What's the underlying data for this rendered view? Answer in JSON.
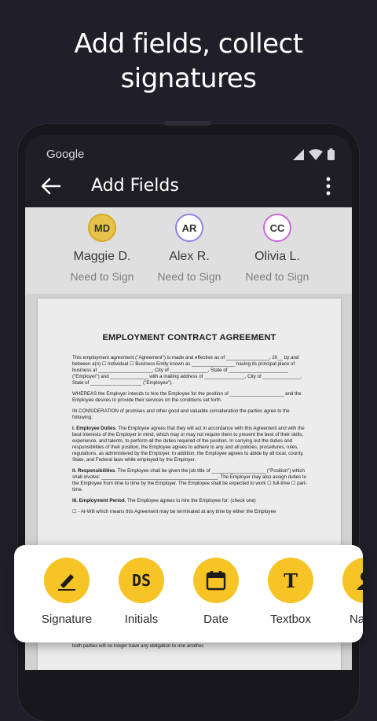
{
  "headline": {
    "line1": "Add fields, collect",
    "line2": "signatures"
  },
  "status_bar": {
    "carrier": "Google",
    "icons": [
      "signal-icon",
      "wifi-icon",
      "battery-icon"
    ]
  },
  "app_bar": {
    "title": "Add Fields",
    "back_icon": "arrow-left-icon",
    "more_icon": "more-vert-icon"
  },
  "signers": [
    {
      "initials": "MD",
      "name": "Maggie D.",
      "status": "Need to Sign",
      "color": "#d4a92a",
      "fill": "#e6c24a"
    },
    {
      "initials": "AR",
      "name": "Alex R.",
      "status": "Need to Sign",
      "color": "#8f82e8",
      "fill": "#ffffff"
    },
    {
      "initials": "CC",
      "name": "Olivia L.",
      "status": "Need to Sign",
      "color": "#c86ad6",
      "fill": "#ffffff"
    }
  ],
  "document": {
    "title": "EMPLOYMENT CONTRACT AGREEMENT",
    "p1": "This employment agreement (\"Agreement\") is made and effective as of ________________, 20__ by and between a(n) ☐ Individual ☐ Business Entity known as ________________ having its principal place of business at ____________________, City of ______________, State of ______________________ (\"Employer\") and ______________ with a mailing address of _______________, City of ______________, State of ___________________ (\"Employee\").",
    "p2": "WHEREAS the Employer intends to hire the Employee for the position of ____________________ and the Employee desires to provide their services on the conditions set forth.",
    "p3": "IN CONSIDERATION of promises and other good and valuable consideration the parties agree to the following:",
    "p4_head": "I. Employee Duties",
    "p4": ". The Employee agrees that they will act in accordance with this Agreement and with the best interests of the Employer in mind, which may or may not require them to present the best of their skills, experience, and talents, to perform all the duties required of the position. In carrying out the duties and responsibilities of their position, the Employee agrees to adhere to any and all policies, procedures, rules, regulations, as administered by the Employer. In addition, the Employee agrees to abide by all local, county, State, and Federal laws while employed by the Employer.",
    "p5_head": "II. Responsibilities",
    "p5": ". The Employee shall be given the job title of ____________________ (\"Position\") which shall involve: ___________________________________________. The Employer may also assign duties to the Employee from time to time by the Employer. The Employee shall be expected to work ☐ full-time ☐ part-time.",
    "p6_head": "III. Employment Period",
    "p6": ". The Employee agrees to hire the Employee for: (check one)",
    "p7": "☐ - At-Will which means this Agreement may be terminated at any time by either the Employee",
    "footer": "both parties will no longer have any obligation to one another."
  },
  "toolbar": {
    "items": [
      {
        "label": "Signature",
        "icon": "pen-signature-icon"
      },
      {
        "label": "Initials",
        "icon": "initials-icon",
        "glyph": "DS"
      },
      {
        "label": "Date",
        "icon": "calendar-icon"
      },
      {
        "label": "Textbox",
        "icon": "textbox-icon",
        "glyph": "T"
      },
      {
        "label": "Name",
        "icon": "person-icon"
      }
    ],
    "accent": "#f6c425"
  }
}
